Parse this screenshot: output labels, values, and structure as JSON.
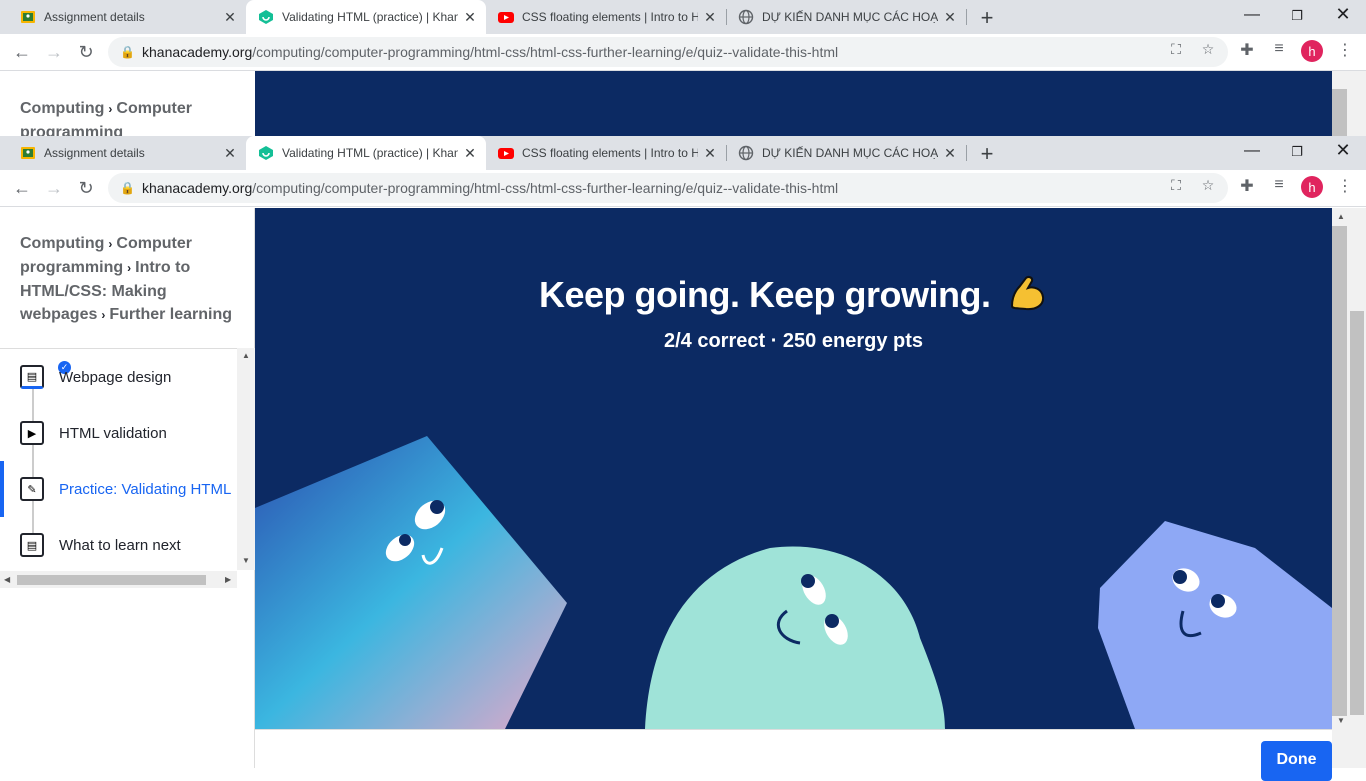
{
  "browser": {
    "tabs": [
      {
        "title": "Assignment details",
        "favicon": "classroom-icon"
      },
      {
        "title": "Validating HTML (practice) | Khan",
        "favicon": "khan-academy-icon"
      },
      {
        "title": "CSS floating elements | Intro to H",
        "favicon": "youtube-icon"
      },
      {
        "title": "DỰ KIẾN DANH MỤC CÁC HOẠT",
        "favicon": "globe-icon"
      }
    ],
    "url_host": "khanacademy.org",
    "url_path": "/computing/computer-programming/html-css/html-css-further-learning/e/quiz--validate-this-html",
    "avatar_letter": "h"
  },
  "sidebar": {
    "breadcrumb": [
      "Computing",
      "Computer programming",
      "Intro to HTML/CSS: Making webpages",
      "Further learning"
    ],
    "lessons": [
      {
        "label": "Webpage design",
        "type": "article",
        "completed": true
      },
      {
        "label": "HTML validation",
        "type": "video",
        "completed": false
      },
      {
        "label": "Practice: Validating HTML",
        "type": "exercise",
        "active": true
      },
      {
        "label": "What to learn next",
        "type": "article",
        "completed": false
      }
    ]
  },
  "hero": {
    "heading": "Keep going. Keep growing.",
    "heading_emoji": "flexed-biceps-icon",
    "summary": "2/4 correct · 250 energy pts"
  },
  "footer": {
    "done_label": "Done"
  },
  "colors": {
    "hero_bg": "#0c2a63",
    "accent": "#1865f2"
  }
}
